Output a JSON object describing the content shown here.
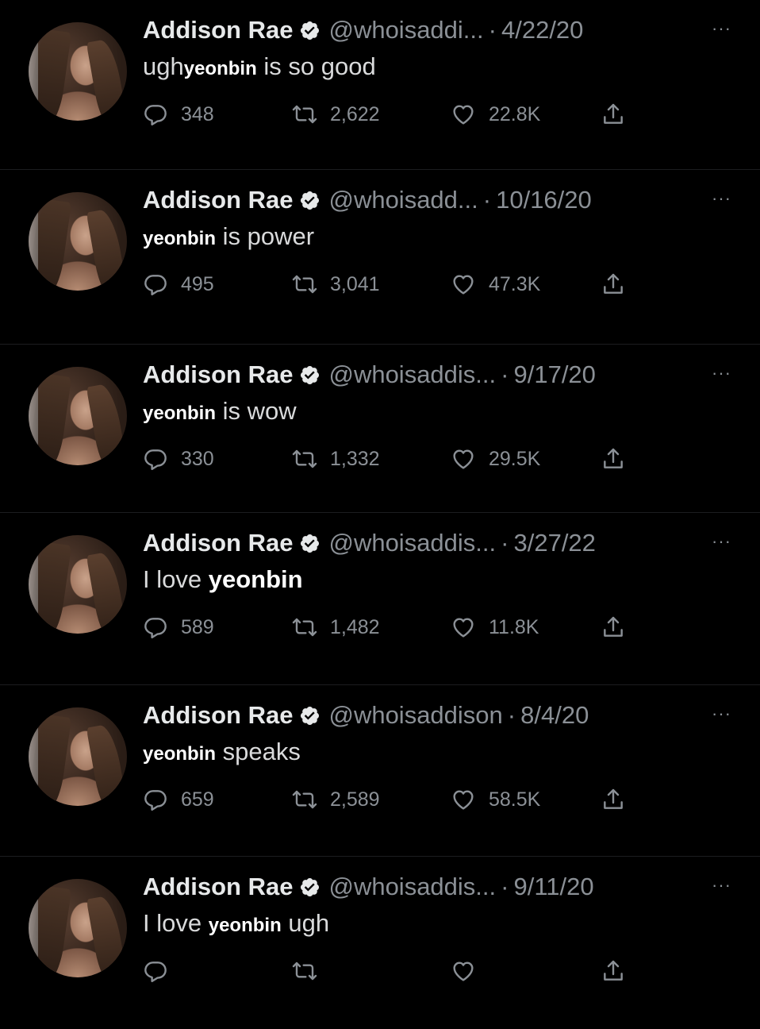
{
  "tweets": [
    {
      "name": "Addison Rae",
      "handle": "@whoisaddi...",
      "date": "4/22/20",
      "text": [
        {
          "t": "ugh"
        },
        {
          "t": "yeonbin",
          "b": true
        },
        {
          "t": " is so good"
        }
      ],
      "replies": "348",
      "retweets": "2,622",
      "likes": "22.8K"
    },
    {
      "name": "Addison Rae",
      "handle": "@whoisadd...",
      "date": "10/16/20",
      "text": [
        {
          "t": "yeonbin",
          "b": true
        },
        {
          "t": " is power"
        }
      ],
      "replies": "495",
      "retweets": "3,041",
      "likes": "47.3K"
    },
    {
      "name": "Addison Rae",
      "handle": "@whoisaddis...",
      "date": "9/17/20",
      "text": [
        {
          "t": "yeonbin",
          "b": true
        },
        {
          "t": " is wow"
        }
      ],
      "replies": "330",
      "retweets": "1,332",
      "likes": "29.5K"
    },
    {
      "name": "Addison Rae",
      "handle": "@whoisaddis...",
      "date": "3/27/22",
      "text": [
        {
          "t": "I love "
        },
        {
          "t": "yeonbin",
          "b": true,
          "big": true
        }
      ],
      "replies": "589",
      "retweets": "1,482",
      "likes": "11.8K"
    },
    {
      "name": "Addison Rae",
      "handle": "@whoisaddison",
      "date": "8/4/20",
      "text": [
        {
          "t": "yeonbin",
          "b": true
        },
        {
          "t": " speaks"
        }
      ],
      "replies": "659",
      "retweets": "2,589",
      "likes": "58.5K"
    },
    {
      "name": "Addison Rae",
      "handle": "@whoisaddis...",
      "date": "9/11/20",
      "text": [
        {
          "t": "I love "
        },
        {
          "t": "yeonbin",
          "b": true
        },
        {
          "t": " ugh"
        }
      ],
      "replies": "",
      "retweets": "",
      "likes": ""
    }
  ],
  "icons": {
    "verified": "verified-badge-icon",
    "more": "more-options-icon",
    "reply": "reply-icon",
    "retweet": "retweet-icon",
    "like": "heart-icon",
    "share": "share-icon"
  },
  "more_glyph": "···",
  "dot_glyph": "·"
}
